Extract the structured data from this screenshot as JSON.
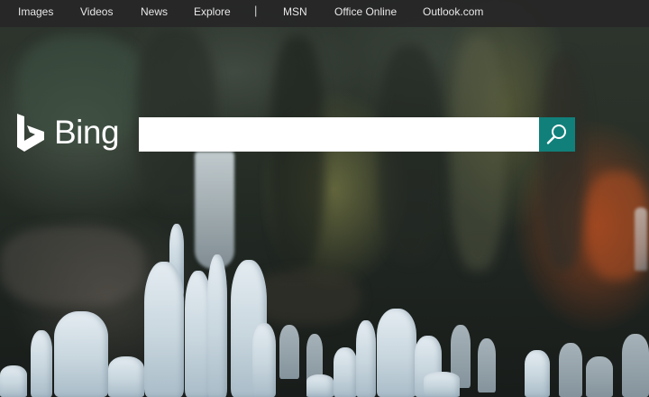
{
  "nav": {
    "items": [
      {
        "label": "Images"
      },
      {
        "label": "Videos"
      },
      {
        "label": "News"
      },
      {
        "label": "Explore"
      }
    ],
    "separator": "|",
    "right_items": [
      {
        "label": "MSN"
      },
      {
        "label": "Office Online"
      },
      {
        "label": "Outlook.com"
      }
    ]
  },
  "logo": {
    "text": "Bing",
    "icon": "bing-b-icon"
  },
  "search": {
    "value": "",
    "placeholder": "",
    "button_icon": "search-icon"
  },
  "colors": {
    "nav_background": "#262626",
    "nav_text": "#e8e8e8",
    "search_button": "#11807b",
    "logo": "#ffffff"
  },
  "background": {
    "description_icon": "ice-cave-photo"
  }
}
